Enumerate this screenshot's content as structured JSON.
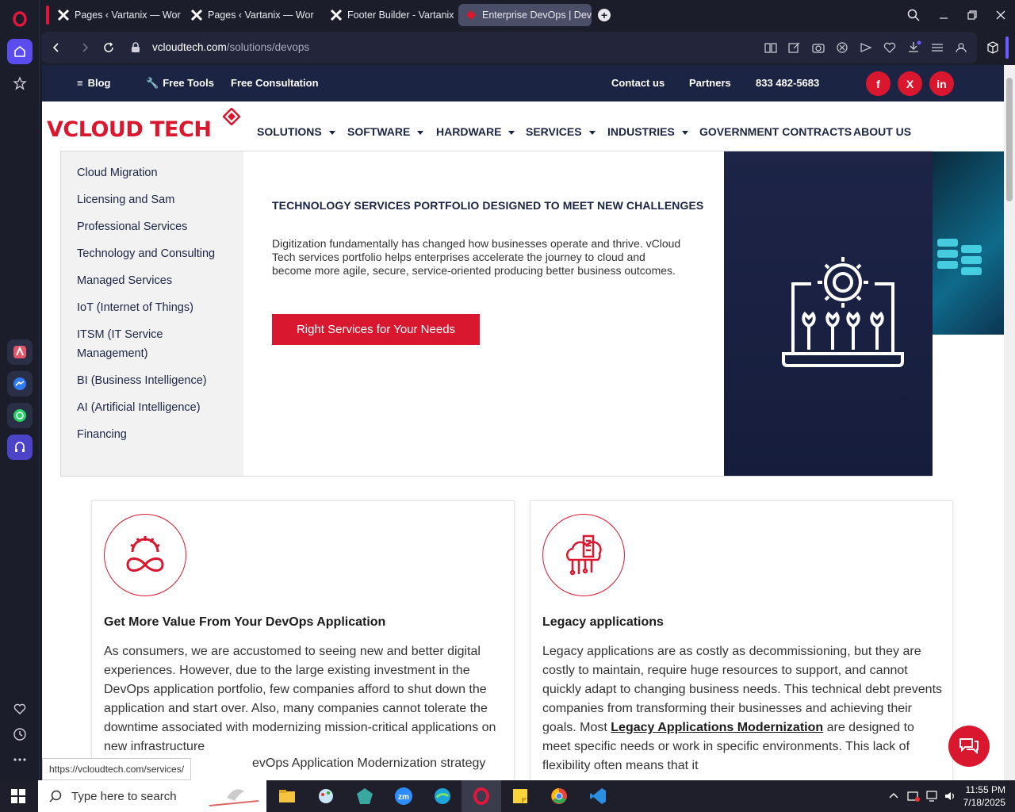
{
  "browser": {
    "tabs": [
      {
        "label": "Pages ‹ Vartanix — WordP"
      },
      {
        "label": "Pages ‹ Vartanix — WordP"
      },
      {
        "label": "Footer Builder - Vartanix"
      },
      {
        "label": "Enterprise DevOps | DevO"
      }
    ],
    "url_domain": "vcloudtech.com",
    "url_path": "/solutions/devops"
  },
  "topbar": {
    "blog": "Blog",
    "free_tools": "Free Tools",
    "free_consultation": "Free Consultation",
    "contact_us": "Contact us",
    "partners": "Partners",
    "phone": "833 482-5683",
    "social": [
      "f",
      "X",
      "in"
    ]
  },
  "logo": {
    "text": "VCLOUD TECH"
  },
  "nav": [
    {
      "label": "SOLUTIONS",
      "has_caret": true
    },
    {
      "label": "SOFTWARE",
      "has_caret": true
    },
    {
      "label": "HARDWARE",
      "has_caret": true
    },
    {
      "label": "SERVICES",
      "has_caret": true
    },
    {
      "label": "INDUSTRIES",
      "has_caret": true
    },
    {
      "label": "GOVERNMENT CONTRACTS",
      "has_caret": false
    },
    {
      "label": "ABOUT US",
      "has_caret": false
    }
  ],
  "dropdown": {
    "items": [
      "Cloud Migration",
      "Licensing and Sam",
      "Professional Services",
      "Technology and Consulting",
      "Managed Services",
      "IoT (Internet of Things)",
      "ITSM (IT Service",
      "Management)",
      "BI  (Business Intelligence)",
      "AI  (Artificial Intelligence)",
      "Financing"
    ],
    "title": "TECHNOLOGY SERVICES PORTFOLIO DESIGNED TO MEET NEW CHALLENGES",
    "description": "Digitization fundamentally has changed how businesses operate and thrive. vCloud Tech services portfolio helps enterprises accelerate the journey to cloud and become more agile, secure, service-oriented producing better business outcomes.",
    "button": "Right Services for Your Needs"
  },
  "cards": [
    {
      "title": "Get More Value From Your DevOps Application",
      "body": "As consumers, we are accustomed to seeing new and better digital experiences. However, due to the large existing investment in the DevOps application portfolio, few companies afford to shut down the application and start over. Also, many companies cannot tolerate the downtime associated with modernizing mission-critical applications on new infrastructure",
      "body_tail": "evOps Application Modernization strategy"
    },
    {
      "title": "Legacy applications",
      "body_1": "Legacy applications are as costly as decommissioning, but they are costly to maintain, require huge resources to support, and cannot quickly adapt to changing business needs. This technical debt prevents companies from transforming their businesses and achieving their goals. Most ",
      "link": "Legacy Applications Modernization",
      "body_2": " are designed to meet specific needs or work in specific environments. This lack of flexibility often means that it"
    }
  ],
  "status_url": "https://vcloudtech.com/services/",
  "taskbar": {
    "search_placeholder": "Type here to search",
    "time": "11:55 PM",
    "date": "7/18/2025"
  },
  "colors": {
    "brand_red": "#d9172e",
    "navy": "#1c2444"
  }
}
